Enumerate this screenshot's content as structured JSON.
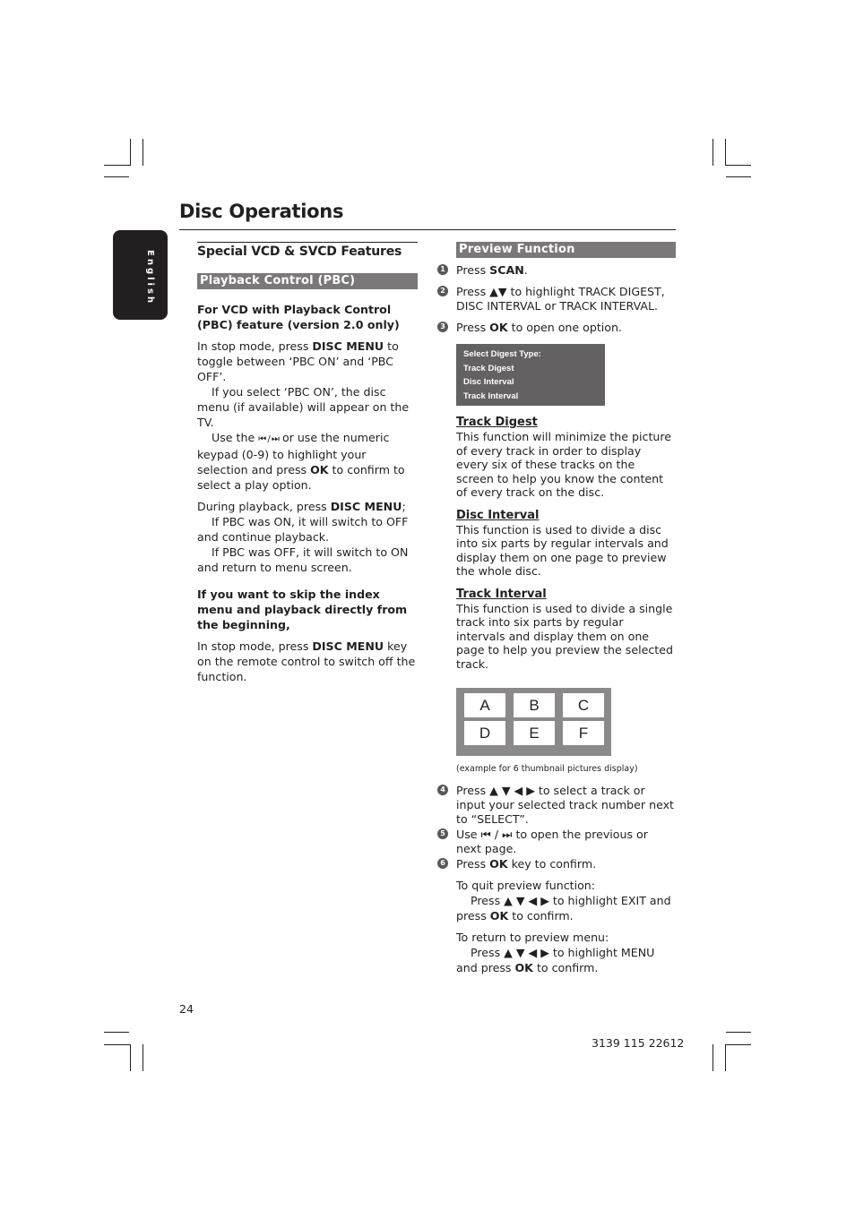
{
  "page": {
    "title": "Disc Operations",
    "language_tab": "English",
    "page_number": "24",
    "document_code": "3139 115 22612"
  },
  "left_column": {
    "section_title": "Special VCD & SVCD Features",
    "subsection_title": "Playback Control (PBC)",
    "intro_bold": "For VCD with Playback Control (PBC) feature (version 2.0 only)",
    "p1": {
      "a": "In stop mode, press ",
      "b": "DISC MENU",
      "c": " to toggle between ‘PBC ON’ and ‘PBC OFF’."
    },
    "p1_note1": "If you select ‘PBC ON’, the disc menu (if available) will appear on the TV.",
    "p1_note2": {
      "a": "Use the ",
      "sym": "⏮ / ⏭",
      "b": " or use the numeric keypad (0-9) to highlight your selection and press ",
      "ok": "OK",
      "c": " to confirm to select a play option."
    },
    "p2": {
      "a": "During playback, press ",
      "b": "DISC MENU",
      "c": ";"
    },
    "p2_note1": "If PBC was ON, it will switch to OFF and continue playback.",
    "p2_note2": "If PBC was OFF, it will switch to ON and return to menu screen.",
    "skip_heading": "If you want to skip the index menu and playback directly from the beginning,",
    "p3": {
      "a": "In stop mode, press ",
      "b": "DISC MENU",
      "c": " key on the remote control to switch off the function."
    }
  },
  "right_column": {
    "section_title": "Preview Function",
    "steps_a": [
      {
        "num": "1",
        "a": "Press ",
        "b": "SCAN",
        "c": "."
      },
      {
        "num": "2",
        "a": "Press ▲▼ to highlight TRACK DIGEST, DISC INTERVAL or TRACK INTERVAL.",
        "b": "",
        "c": ""
      },
      {
        "num": "3",
        "a": "Press ",
        "b": "OK",
        "c": " to open one option."
      }
    ],
    "osd_menu": {
      "header": "Select Digest Type:",
      "items": [
        "Track Digest",
        "Disc Interval",
        "Track Interval"
      ]
    },
    "modes": [
      {
        "title": "Track Digest",
        "text": "This function will minimize the picture of every track in order to display every six of these tracks on the screen to help you know the content of every track on the disc."
      },
      {
        "title": "Disc Interval",
        "text": "This function is used to divide a disc into six parts by regular intervals and display them on one page to preview the whole disc."
      },
      {
        "title": "Track Interval",
        "text": "This function is used to divide a single track into six parts by regular intervals and display them on one page to help you preview the selected track."
      }
    ],
    "thumbnails": [
      "A",
      "B",
      "C",
      "D",
      "E",
      "F"
    ],
    "thumbnail_caption": "(example for 6 thumbnail pictures display)",
    "steps_b": [
      {
        "num": "4",
        "a": "Press ▲ ▼ ◀ ▶ to select a track or input your selected track number next to “SELECT”.",
        "b": "",
        "c": ""
      },
      {
        "num": "5",
        "a": "Use ⏮ / ⏭ to open the previous or next page.",
        "b": "",
        "c": ""
      },
      {
        "num": "6",
        "a": "Press ",
        "b": "OK",
        "c": " key to confirm."
      }
    ],
    "quit": {
      "label": "To quit preview function:",
      "a": "Press ▲ ▼ ◀ ▶ to highlight EXIT and press ",
      "b": "OK",
      "c": " to confirm."
    },
    "return": {
      "label": "To return to preview menu:",
      "a": "Press ▲ ▼ ◀ ▶ to highlight MENU and press ",
      "b": "OK",
      "c": " to confirm."
    }
  }
}
